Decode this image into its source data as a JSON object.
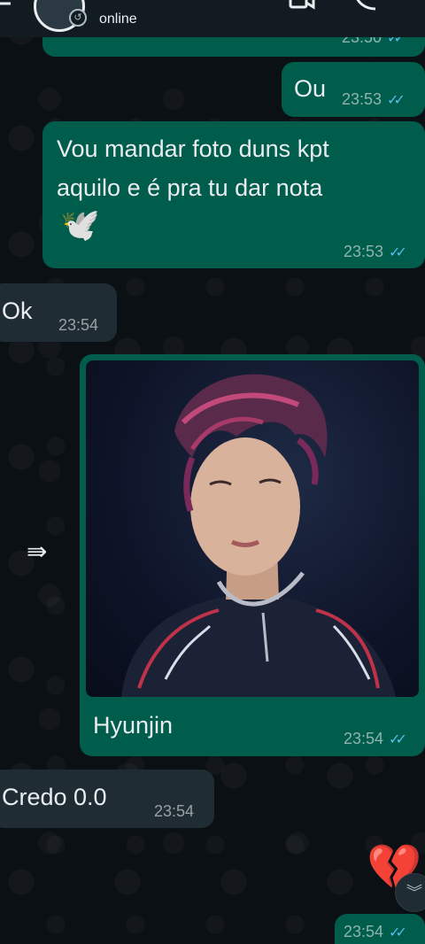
{
  "header": {
    "contact_name": "",
    "status": "online"
  },
  "messages": [
    {
      "type": "out",
      "text": "",
      "time": "23:50"
    },
    {
      "type": "out",
      "text": "Ou",
      "time": "23:53"
    },
    {
      "type": "out",
      "text_line1": "Vou mandar foto duns kpt",
      "text_line2": "aquilo e é pra tu dar nota",
      "emoji": "🕊️",
      "time": "23:53"
    },
    {
      "type": "in",
      "text": "Ok",
      "time": "23:54"
    },
    {
      "type": "out",
      "caption": "Hyunjin",
      "time": "23:54",
      "image": "photo of a person with dark reddish-purple messy hair"
    },
    {
      "type": "in",
      "text": "Credo 0.0",
      "time": "23:54"
    },
    {
      "type": "out",
      "emoji": "💔",
      "time": "23:54"
    }
  ],
  "icons": {
    "ticks": "✓✓",
    "forward": "⇛",
    "scroll_down": "︾"
  },
  "colors": {
    "outgoing": "#005c4b",
    "incoming": "#202c33",
    "read_ticks": "#53bdeb",
    "background": "#0b1014"
  }
}
